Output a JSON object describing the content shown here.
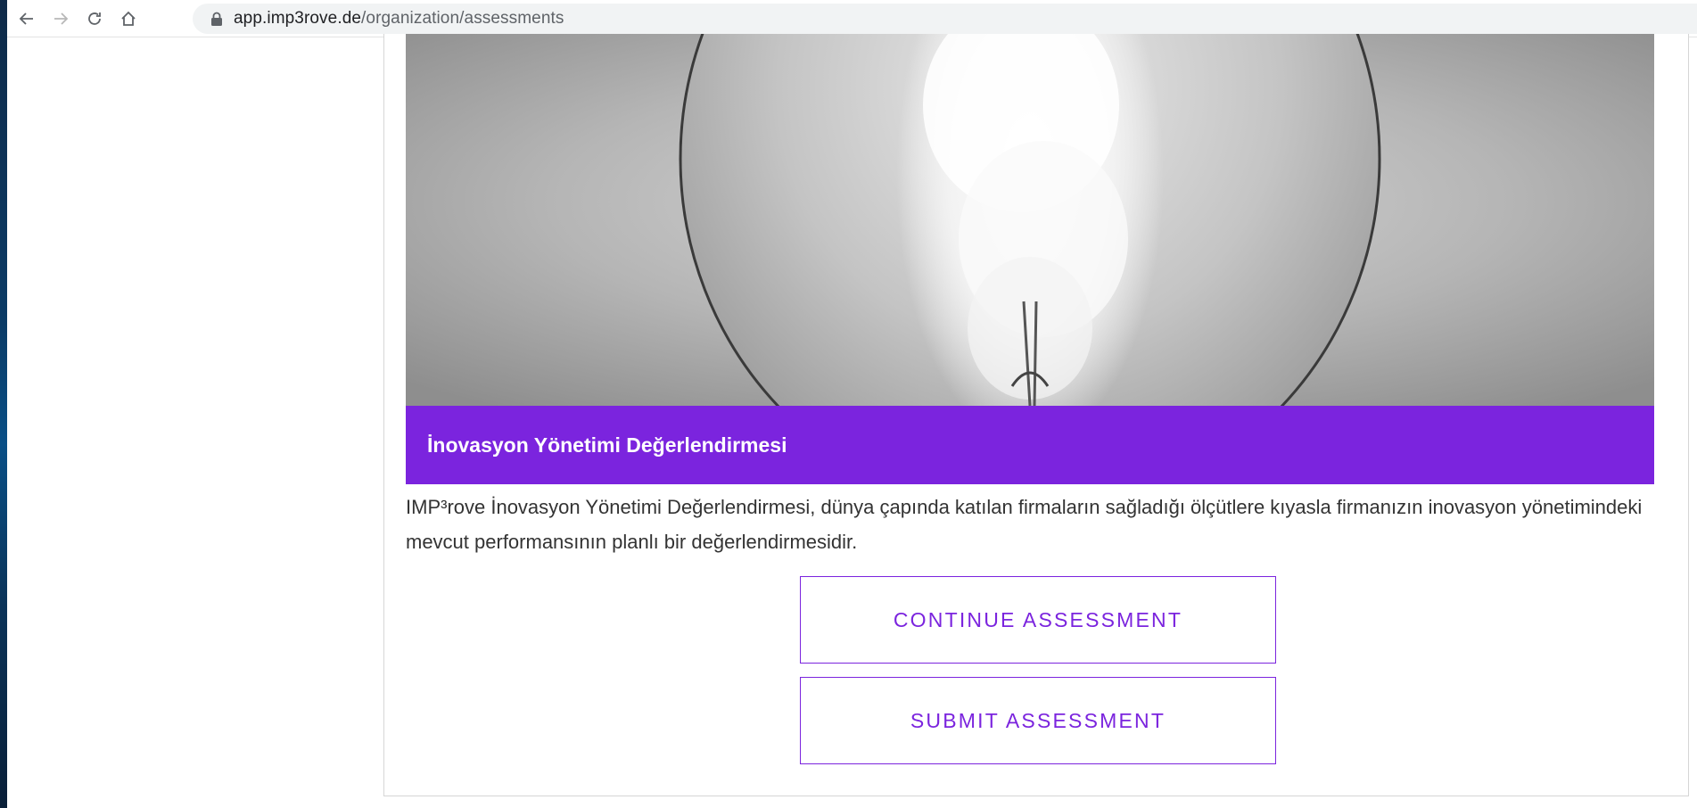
{
  "browser": {
    "url_host": "app.imp3rove.de",
    "url_path": "/organization/assessments",
    "icons": {
      "back": "arrow-left-icon",
      "forward": "arrow-right-icon",
      "reload": "reload-icon",
      "home": "home-icon",
      "lock": "lock-icon"
    }
  },
  "assessment": {
    "hero_image": "light-bulb-photo",
    "title": "İnovasyon Yönetimi Değerlendirmesi",
    "description": "IMP³rove İnovasyon Yönetimi Değerlendirmesi, dünya çapında katılan firmaların sağladığı ölçütlere kıyasla firmanızın inovasyon yönetimindeki mevcut performansının planlı bir değerlendirmesidir.",
    "continue_label": "CONTINUE ASSESSMENT",
    "submit_label": "SUBMIT ASSESSMENT"
  },
  "colors": {
    "accent": "#7b24de",
    "text": "#333333",
    "border": "#d6d6d6"
  }
}
